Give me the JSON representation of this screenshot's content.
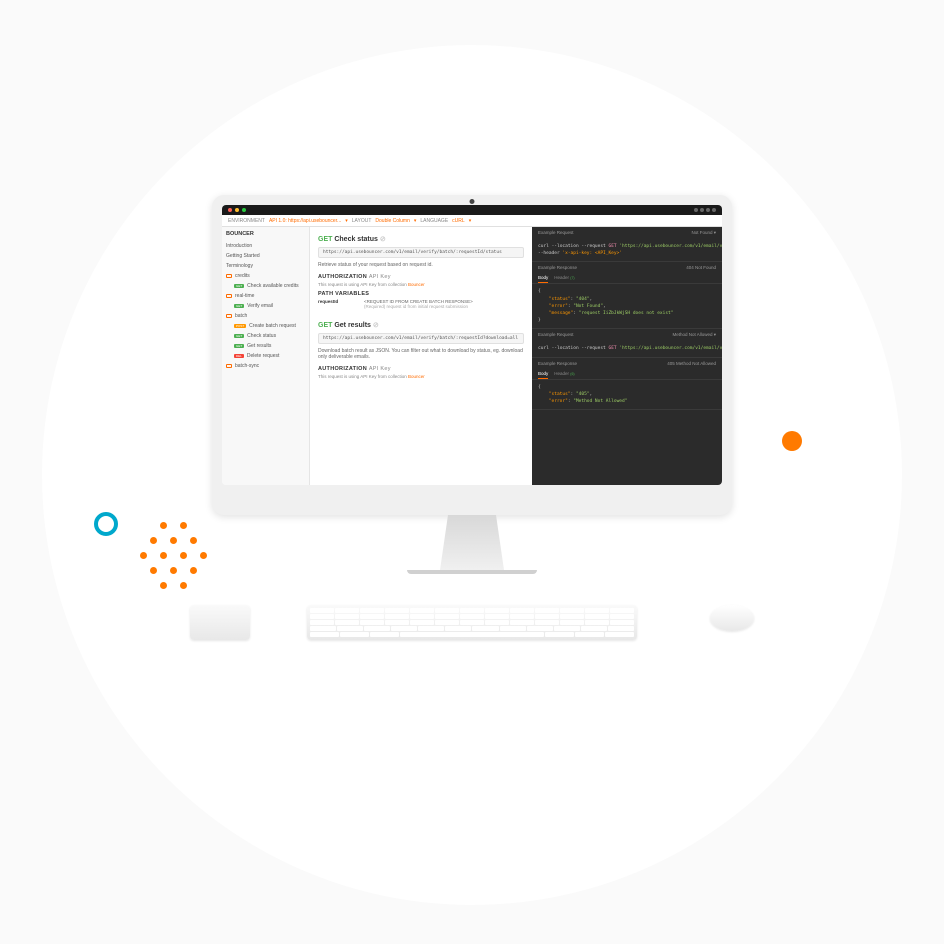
{
  "toolbar": {
    "env_label": "ENVIRONMENT",
    "env_value": "API 1.0: https://api.usebouncer...",
    "layout_label": "LAYOUT",
    "layout_value": "Double Column",
    "lang_label": "LANGUAGE",
    "lang_value": "cURL"
  },
  "sidebar": {
    "title": "BOUNCER",
    "items": [
      {
        "label": "Introduction",
        "type": "link"
      },
      {
        "label": "Getting Started",
        "type": "link"
      },
      {
        "label": "Terminology",
        "type": "link"
      },
      {
        "label": "credits",
        "type": "folder"
      },
      {
        "label": "Check available credits",
        "type": "get",
        "sub": true
      },
      {
        "label": "real-time",
        "type": "folder"
      },
      {
        "label": "Verify email",
        "type": "get",
        "sub": true
      },
      {
        "label": "batch",
        "type": "folder"
      },
      {
        "label": "Create batch request",
        "type": "post",
        "sub": true
      },
      {
        "label": "Check status",
        "type": "get",
        "sub": true
      },
      {
        "label": "Get results",
        "type": "get",
        "sub": true
      },
      {
        "label": "Delete request",
        "type": "del",
        "sub": true
      },
      {
        "label": "batch-sync",
        "type": "folder"
      }
    ]
  },
  "endpoints": [
    {
      "method": "GET",
      "title": "Check status",
      "url": "https://api.usebouncer.com/v1/email/verify/batch/:requestId/status",
      "desc": "Retrieve status of your request based on request id.",
      "auth_label": "AUTHORIZATION",
      "auth_type": "API Key",
      "auth_desc": "This request is using API Key from collection ",
      "auth_link": "Bouncer",
      "path_label": "PATH VARIABLES",
      "params": [
        {
          "name": "requestId",
          "value": "<REQUEST ID FROM CREATE BATCH RESPONSE>",
          "desc": "(Required) request id from initial request submission"
        }
      ]
    },
    {
      "method": "GET",
      "title": "Get results",
      "url": "https://api.usebouncer.com/v1/email/verify/batch/:requestId?download=all",
      "desc": "Download batch result as JSON. You can filter out what to download by status, eg. download only deliverable emails.",
      "auth_label": "AUTHORIZATION",
      "auth_type": "API Key",
      "auth_desc": "This request is using API Key from collection ",
      "auth_link": "Bouncer"
    }
  ],
  "code": {
    "req1": {
      "label": "Example Request",
      "status": "Not Found",
      "curl": "curl",
      "loc": "--location",
      "reqf": "--request",
      "method": "GET",
      "url": "'https://api.usebouncer.com/v1/email/verify/batc",
      "hdr": "--header",
      "hkey": "'x-api-key: <API_Key>'"
    },
    "res1": {
      "label": "Example Response",
      "status": "404 Not Found",
      "body_tab": "Body",
      "header_tab": "Header",
      "header_count": "(7)",
      "json_status_k": "\"status\"",
      "json_status_v": "\"404\"",
      "json_error_k": "\"error\"",
      "json_error_v": "\"Not Found\"",
      "json_msg_k": "\"message\"",
      "json_msg_v": "\"request IiZbJkWjSH does not exist\""
    },
    "req2": {
      "label": "Example Request",
      "status": "Method Not Allowed",
      "curl": "curl",
      "loc": "--location",
      "reqf": "--request",
      "method": "GET",
      "url": "'https://api.usebouncer.com/v1/email/verify/batc"
    },
    "res2": {
      "label": "Example Response",
      "status": "405 Method Not Allowed",
      "body_tab": "Body",
      "header_tab": "Header",
      "header_count": "(6)",
      "json_status_k": "\"status\"",
      "json_status_v": "\"405\"",
      "json_error_k": "\"error\"",
      "json_error_v": "\"Method Not Allowed\""
    }
  }
}
